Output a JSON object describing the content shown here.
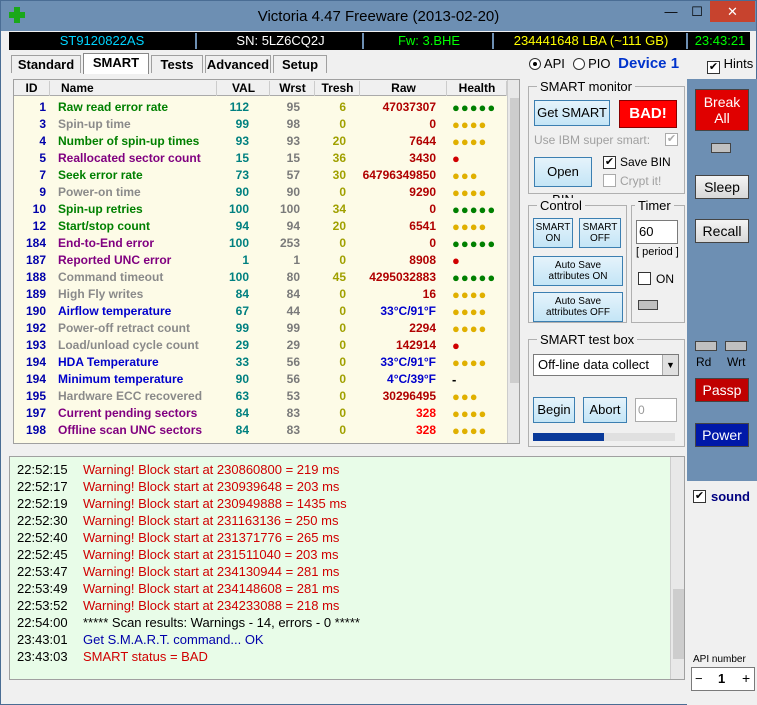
{
  "window": {
    "title": "Victoria 4.47  Freeware (2013-02-20)",
    "min": "—",
    "max": "☐",
    "close": "✕"
  },
  "info": {
    "model": "ST9120822AS",
    "sn": "SN: 5LZ6CQ2J",
    "fw": "Fw: 3.BHE",
    "lba": "234441648 LBA (~111 GB)",
    "time": "23:43:21"
  },
  "tabs": [
    "Standard",
    "SMART",
    "Tests",
    "Advanced",
    "Setup"
  ],
  "api": {
    "api_label": "API",
    "pio_label": "PIO",
    "device": "Device 1",
    "hints": "Hints"
  },
  "table": {
    "headers": [
      "ID",
      "Name",
      "VAL",
      "Wrst",
      "Tresh",
      "Raw",
      "Health"
    ],
    "rows": [
      {
        "id": "1",
        "name": "Raw read error rate",
        "val": "112",
        "wrst": "95",
        "tresh": "6",
        "raw": "47037307",
        "health": "●●●●●",
        "name_color": "#008000",
        "health_color": "#008000"
      },
      {
        "id": "3",
        "name": "Spin-up time",
        "val": "99",
        "wrst": "98",
        "tresh": "0",
        "raw": "0",
        "health": "●●●●",
        "name_color": "#8a8a8a",
        "health_color": "#e0b000"
      },
      {
        "id": "4",
        "name": "Number of spin-up times",
        "val": "93",
        "wrst": "93",
        "tresh": "20",
        "raw": "7644",
        "health": "●●●●",
        "name_color": "#008000",
        "health_color": "#e0b000"
      },
      {
        "id": "5",
        "name": "Reallocated sector count",
        "val": "15",
        "wrst": "15",
        "tresh": "36",
        "raw": "3430",
        "health": "●",
        "name_color": "#800080",
        "health_color": "#d00000"
      },
      {
        "id": "7",
        "name": "Seek error rate",
        "val": "73",
        "wrst": "57",
        "tresh": "30",
        "raw": "64796349850",
        "health": "●●●",
        "name_color": "#008000",
        "health_color": "#e0b000"
      },
      {
        "id": "9",
        "name": "Power-on time",
        "val": "90",
        "wrst": "90",
        "tresh": "0",
        "raw": "9290",
        "health": "●●●●",
        "name_color": "#8a8a8a",
        "health_color": "#e0b000"
      },
      {
        "id": "10",
        "name": "Spin-up retries",
        "val": "100",
        "wrst": "100",
        "tresh": "34",
        "raw": "0",
        "health": "●●●●●",
        "name_color": "#008000",
        "health_color": "#008000"
      },
      {
        "id": "12",
        "name": "Start/stop count",
        "val": "94",
        "wrst": "94",
        "tresh": "20",
        "raw": "6541",
        "health": "●●●●",
        "name_color": "#008000",
        "health_color": "#e0b000"
      },
      {
        "id": "184",
        "name": "End-to-End error",
        "val": "100",
        "wrst": "253",
        "tresh": "0",
        "raw": "0",
        "health": "●●●●●",
        "name_color": "#800080",
        "health_color": "#008000"
      },
      {
        "id": "187",
        "name": "Reported UNC error",
        "val": "1",
        "wrst": "1",
        "tresh": "0",
        "raw": "8908",
        "health": "●",
        "name_color": "#800080",
        "health_color": "#d00000"
      },
      {
        "id": "188",
        "name": "Command timeout",
        "val": "100",
        "wrst": "80",
        "tresh": "45",
        "raw": "4295032883",
        "health": "●●●●●",
        "name_color": "#8a8a8a",
        "health_color": "#008000"
      },
      {
        "id": "189",
        "name": "High Fly writes",
        "val": "84",
        "wrst": "84",
        "tresh": "0",
        "raw": "16",
        "health": "●●●●",
        "name_color": "#8a8a8a",
        "health_color": "#e0b000"
      },
      {
        "id": "190",
        "name": "Airflow temperature",
        "val": "67",
        "wrst": "44",
        "tresh": "0",
        "raw": "33°C/91°F",
        "health": "●●●●",
        "name_color": "#0000cc",
        "health_color": "#e0b000",
        "raw_color": "#0000cc"
      },
      {
        "id": "192",
        "name": "Power-off retract count",
        "val": "99",
        "wrst": "99",
        "tresh": "0",
        "raw": "2294",
        "health": "●●●●",
        "name_color": "#8a8a8a",
        "health_color": "#e0b000"
      },
      {
        "id": "193",
        "name": "Load/unload cycle count",
        "val": "29",
        "wrst": "29",
        "tresh": "0",
        "raw": "142914",
        "health": "●",
        "name_color": "#8a8a8a",
        "health_color": "#d00000"
      },
      {
        "id": "194",
        "name": "HDA Temperature",
        "val": "33",
        "wrst": "56",
        "tresh": "0",
        "raw": "33°C/91°F",
        "health": "●●●●",
        "name_color": "#0000cc",
        "health_color": "#e0b000",
        "raw_color": "#0000cc"
      },
      {
        "id": "194",
        "name": "Minimum temperature",
        "val": "90",
        "wrst": "56",
        "tresh": "0",
        "raw": "4°C/39°F",
        "health": "-",
        "name_color": "#0000cc",
        "health_color": "#000000",
        "raw_color": "#0000cc"
      },
      {
        "id": "195",
        "name": "Hardware ECC recovered",
        "val": "63",
        "wrst": "53",
        "tresh": "0",
        "raw": "30296495",
        "health": "●●●",
        "name_color": "#8a8a8a",
        "health_color": "#e0b000"
      },
      {
        "id": "197",
        "name": "Current pending sectors",
        "val": "84",
        "wrst": "83",
        "tresh": "0",
        "raw": "328",
        "health": "●●●●",
        "name_color": "#800080",
        "health_color": "#e0b000",
        "raw_color": "#ff0000"
      },
      {
        "id": "198",
        "name": "Offline scan UNC sectors",
        "val": "84",
        "wrst": "83",
        "tresh": "0",
        "raw": "328",
        "health": "●●●●",
        "name_color": "#800080",
        "health_color": "#e0b000",
        "raw_color": "#ff0000"
      }
    ]
  },
  "smart_monitor": {
    "title": "SMART monitor",
    "get_smart": "Get SMART",
    "status": "BAD!",
    "ibm_label": "Use IBM super smart:",
    "open_bin": "Open BIN",
    "save_bin": "Save BIN",
    "crypt_it": "Crypt it!"
  },
  "control": {
    "title": "Control",
    "smart_on": "SMART ON",
    "smart_off": "SMART OFF",
    "autosave_on": "Auto Save attributes ON",
    "autosave_off": "Auto Save attributes OFF"
  },
  "timer": {
    "title": "Timer",
    "value": "60",
    "period": "[ period ]",
    "on_label": "ON"
  },
  "test_box": {
    "title": "SMART test box",
    "selected": "Off-line data collect",
    "begin": "Begin",
    "abort": "Abort",
    "progress_value": "0"
  },
  "side": {
    "break_all": "Break All",
    "sleep": "Sleep",
    "recall": "Recall",
    "rd": "Rd",
    "wrt": "Wrt",
    "passp": "Passp",
    "power": "Power",
    "sound": "sound",
    "api_number_label": "API number",
    "api_number": "1",
    "minus": "−",
    "plus": "+"
  },
  "log": [
    {
      "time": "22:52:15",
      "msg": "Warning! Block start at 230860800 = 219 ms",
      "color": "#d00000"
    },
    {
      "time": "22:52:17",
      "msg": "Warning! Block start at 230939648 = 203 ms",
      "color": "#d00000"
    },
    {
      "time": "22:52:19",
      "msg": "Warning! Block start at 230949888 = 1435 ms",
      "color": "#d00000"
    },
    {
      "time": "22:52:30",
      "msg": "Warning! Block start at 231163136 = 250 ms",
      "color": "#d00000"
    },
    {
      "time": "22:52:40",
      "msg": "Warning! Block start at 231371776 = 265 ms",
      "color": "#d00000"
    },
    {
      "time": "22:52:45",
      "msg": "Warning! Block start at 231511040 = 203 ms",
      "color": "#d00000"
    },
    {
      "time": "22:53:47",
      "msg": "Warning! Block start at 234130944 = 281 ms",
      "color": "#d00000"
    },
    {
      "time": "22:53:49",
      "msg": "Warning! Block start at 234148608 = 281 ms",
      "color": "#d00000"
    },
    {
      "time": "22:53:52",
      "msg": "Warning! Block start at 234233088 = 218 ms",
      "color": "#d00000"
    },
    {
      "time": "22:54:00",
      "msg": "***** Scan results: Warnings - 14, errors - 0 *****",
      "color": "#000000"
    },
    {
      "time": "23:43:01",
      "msg": "Get S.M.A.R.T. command... OK",
      "color": "#0000aa"
    },
    {
      "time": "23:43:03",
      "msg": "SMART status = BAD",
      "color": "#d00000"
    }
  ]
}
